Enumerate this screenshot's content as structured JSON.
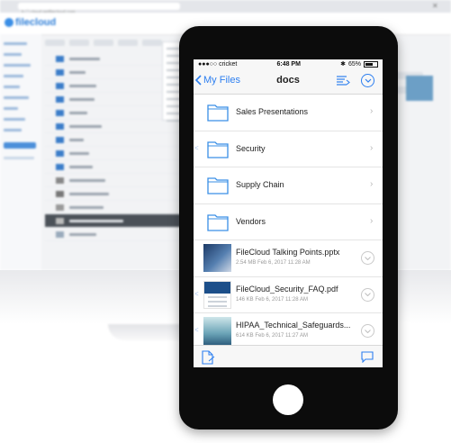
{
  "desktop": {
    "url": "h ☐ cloud.getfilecloud.com",
    "logo_text": "filecloud",
    "close_glyph": "✕"
  },
  "status_bar": {
    "carrier": "●●●○○ cricket",
    "time": "6:48 PM",
    "bluetooth": "✱",
    "battery_percent": "65%"
  },
  "nav": {
    "back_label": "My Files",
    "title": "docs"
  },
  "folders": [
    {
      "name": "Sales Presentations",
      "swipe": false
    },
    {
      "name": "Security",
      "swipe": true
    },
    {
      "name": "Supply Chain",
      "swipe": false
    },
    {
      "name": "Vendors",
      "swipe": false
    }
  ],
  "files": [
    {
      "name": "FileCloud Talking Points.pptx",
      "meta": "2.54 MB  Feb 6, 2017 11:28 AM",
      "thumb": "presentation-thumb"
    },
    {
      "name": "FileCloud_Security_FAQ.pdf",
      "meta": "146 KB  Feb 6, 2017 11:28 AM",
      "thumb": "pdf-thumb"
    },
    {
      "name": "HIPAA_Technical_Safeguards...",
      "meta": "614 KB  Feb 6, 2017 11:27 AM",
      "thumb": "document-thumb"
    }
  ],
  "chevron": "›",
  "swipe_hint": "<",
  "colors": {
    "accent": "#2d7ff0",
    "phone_body": "#0c0c0c"
  }
}
